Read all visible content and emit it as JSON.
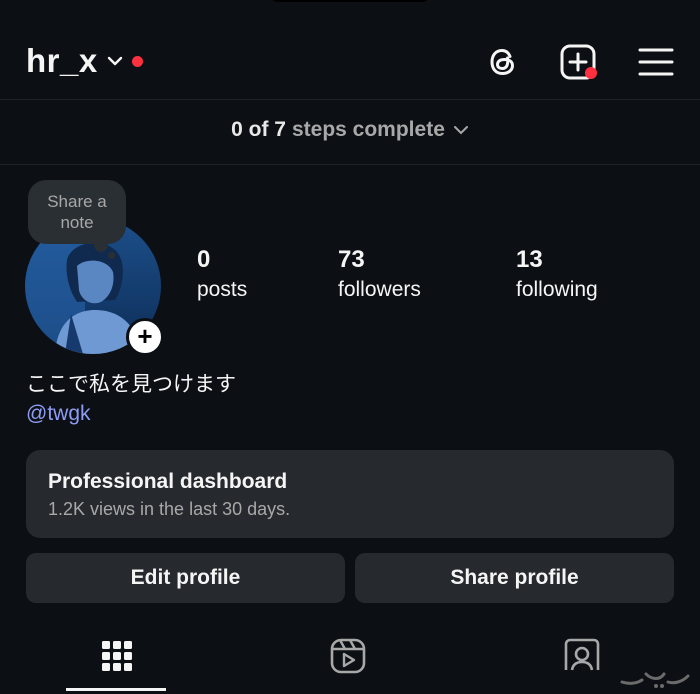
{
  "header": {
    "username": "hr_x",
    "icons": [
      "chevron-down-icon",
      "threads-icon",
      "create-icon",
      "menu-icon"
    ],
    "notification_color": "#ff3040"
  },
  "steps": {
    "count": "0 of 7",
    "label": "steps complete"
  },
  "note": {
    "line1": "Share a",
    "line2": "note"
  },
  "stats": {
    "posts": {
      "value": "0",
      "label": "posts"
    },
    "followers": {
      "value": "73",
      "label": "followers"
    },
    "following": {
      "value": "13",
      "label": "following"
    }
  },
  "bio": {
    "text": "ここで私を見つけます",
    "handle": "@twgk"
  },
  "dashboard": {
    "title": "Professional dashboard",
    "subtitle": "1.2K views in the last 30 days."
  },
  "buttons": {
    "edit": "Edit profile",
    "share": "Share profile"
  },
  "tabs": [
    "grid-icon",
    "reels-icon",
    "tagged-icon"
  ],
  "colors": {
    "background": "#0c1014",
    "card": "#262a2e",
    "link": "#8e9cf5"
  }
}
